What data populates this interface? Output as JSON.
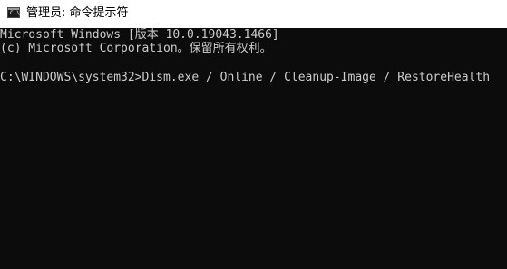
{
  "window": {
    "title": "管理员: 命令提示符",
    "icon": "cmd-icon",
    "icon_glyph": "C:\\"
  },
  "console": {
    "lines": [
      "Microsoft Windows [版本 10.0.19043.1466]",
      "(c) Microsoft Corporation。保留所有权利。",
      "C:\\WINDOWS\\system32>Dism.exe / Online / Cleanup-Image / RestoreHealth"
    ]
  },
  "colors": {
    "console_bg": "#0c0c0c",
    "console_text": "#cccccc",
    "titlebar_bg": "#ffffff",
    "title_text": "#000000"
  }
}
